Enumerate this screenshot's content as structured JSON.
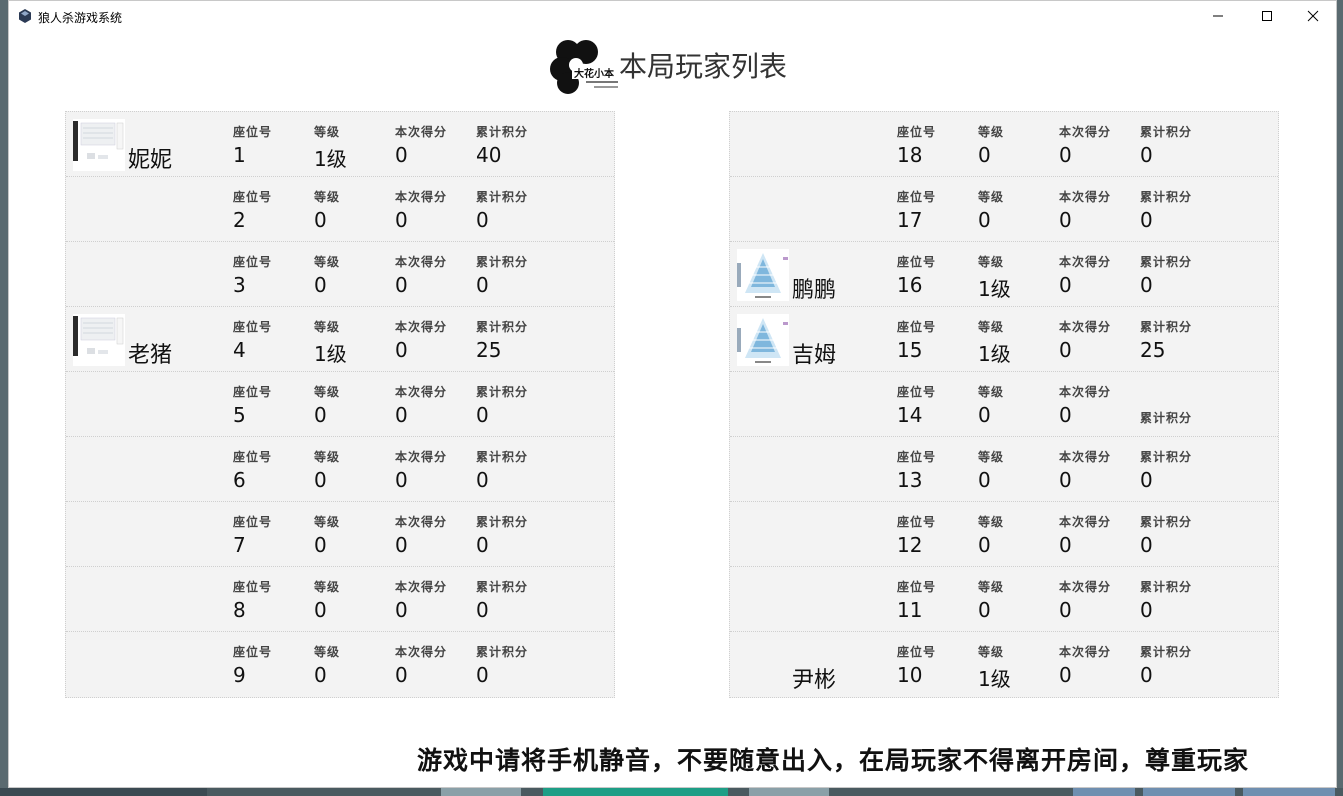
{
  "window": {
    "title": "狼人杀游戏系统"
  },
  "header": {
    "title": "本局玩家列表",
    "logo_text": "大花小本"
  },
  "labels": {
    "seat": "座位号",
    "level": "等级",
    "round_score": "本次得分",
    "total_score": "累计积分"
  },
  "left_players": [
    {
      "name": "妮妮",
      "avatar": "screenshot-avatar",
      "seat": "1",
      "level": "1级",
      "round_score": "0",
      "total_score": "40"
    },
    {
      "name": "",
      "avatar": "",
      "seat": "2",
      "level": "0",
      "round_score": "0",
      "total_score": "0"
    },
    {
      "name": "",
      "avatar": "",
      "seat": "3",
      "level": "0",
      "round_score": "0",
      "total_score": "0"
    },
    {
      "name": "老猪",
      "avatar": "screenshot-avatar",
      "seat": "4",
      "level": "1级",
      "round_score": "0",
      "total_score": "25"
    },
    {
      "name": "",
      "avatar": "",
      "seat": "5",
      "level": "0",
      "round_score": "0",
      "total_score": "0"
    },
    {
      "name": "",
      "avatar": "",
      "seat": "6",
      "level": "0",
      "round_score": "0",
      "total_score": "0"
    },
    {
      "name": "",
      "avatar": "",
      "seat": "7",
      "level": "0",
      "round_score": "0",
      "total_score": "0"
    },
    {
      "name": "",
      "avatar": "",
      "seat": "8",
      "level": "0",
      "round_score": "0",
      "total_score": "0"
    },
    {
      "name": "",
      "avatar": "",
      "seat": "9",
      "level": "0",
      "round_score": "0",
      "total_score": "0"
    }
  ],
  "right_players": [
    {
      "name": "",
      "avatar": "",
      "seat": "18",
      "level": "0",
      "round_score": "0",
      "total_score": "0"
    },
    {
      "name": "",
      "avatar": "",
      "seat": "17",
      "level": "0",
      "round_score": "0",
      "total_score": "0"
    },
    {
      "name": "鹏鹏",
      "avatar": "pyramid-avatar",
      "seat": "16",
      "level": "1级",
      "round_score": "0",
      "total_score": "0"
    },
    {
      "name": "吉姆",
      "avatar": "pyramid-avatar",
      "seat": "15",
      "level": "1级",
      "round_score": "0",
      "total_score": "25"
    },
    {
      "name": "",
      "avatar": "",
      "seat": "14",
      "level": "0",
      "round_score": "0",
      "total_score": ""
    },
    {
      "name": "",
      "avatar": "",
      "seat": "13",
      "level": "0",
      "round_score": "0",
      "total_score": "0"
    },
    {
      "name": "",
      "avatar": "",
      "seat": "12",
      "level": "0",
      "round_score": "0",
      "total_score": "0"
    },
    {
      "name": "",
      "avatar": "",
      "seat": "11",
      "level": "0",
      "round_score": "0",
      "total_score": "0"
    },
    {
      "name": "尹彬",
      "avatar": "",
      "seat": "10",
      "level": "1级",
      "round_score": "0",
      "total_score": "0"
    }
  ],
  "notice": "游戏中请将手机静音，不要随意出入，在局玩家不得离开房间，尊重玩家",
  "colors": {
    "panel_bg": "#f3f3f3",
    "window_bg": "#ffffff",
    "text": "#111111"
  }
}
